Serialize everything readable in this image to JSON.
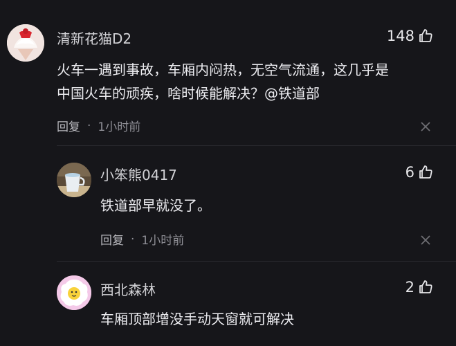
{
  "comments": [
    {
      "username": "清新花猫D2",
      "likes": "148",
      "text_lines": [
        "火车一遇到事故，车厢内闷热，无空气流通，这几乎是",
        "中国火车的顽疾，啥时候能解决？@铁道部"
      ],
      "reply_label": "回复",
      "separator": "·",
      "time": "1小时前",
      "avatar_icon": "ice-cream-avatar-icon"
    },
    {
      "username": "小笨熊0417",
      "likes": "6",
      "text_lines": [
        "铁道部早就没了。"
      ],
      "reply_label": "回复",
      "separator": "·",
      "time": "1小时前",
      "avatar_icon": "cup-photo-avatar-icon"
    },
    {
      "username": "西北森林",
      "likes": "2",
      "text_lines": [
        "车厢顶部增没手动天窗就可解决"
      ],
      "avatar_icon": "fried-egg-avatar-icon"
    }
  ],
  "colors": {
    "background": "#16161a",
    "text": "#ececf0",
    "muted": "#8f8f96"
  }
}
